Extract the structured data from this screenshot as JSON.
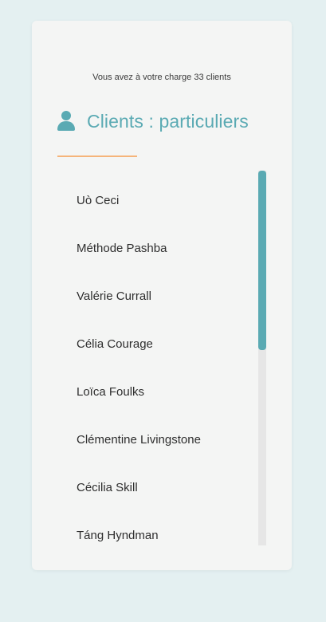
{
  "summary": {
    "count_text": "Vous avez à votre charge 33 clients"
  },
  "header": {
    "icon": "user-icon",
    "title": "Clients : particuliers"
  },
  "clients": [
    {
      "name": "Uò Ceci"
    },
    {
      "name": "Méthode Pashba"
    },
    {
      "name": "Valérie Currall"
    },
    {
      "name": "Célia Courage"
    },
    {
      "name": "Loïca Foulks"
    },
    {
      "name": "Clémentine Livingstone"
    },
    {
      "name": "Cécilia Skill"
    },
    {
      "name": "Táng Hyndman"
    }
  ],
  "colors": {
    "accent": "#5aaab3",
    "underline": "#f5b47a",
    "background": "#e4f0f1",
    "card": "#f4f5f4"
  }
}
